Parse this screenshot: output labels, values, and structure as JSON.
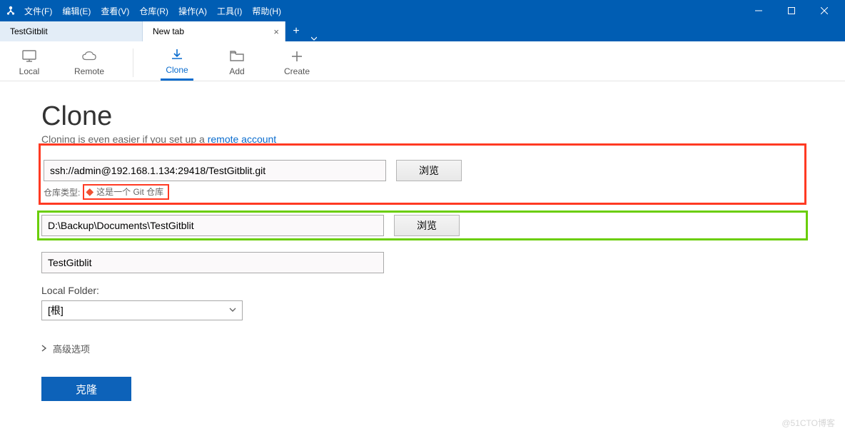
{
  "menu": {
    "file": "文件(F)",
    "edit": "编辑(E)",
    "view": "查看(V)",
    "repo": "仓库(R)",
    "action": "操作(A)",
    "tools": "工具(I)",
    "help": "帮助(H)"
  },
  "tabs": {
    "t1": "TestGitblit",
    "t2": "New tab"
  },
  "toolbar": {
    "local": "Local",
    "remote": "Remote",
    "clone": "Clone",
    "add": "Add",
    "create": "Create"
  },
  "page": {
    "heading": "Clone",
    "subtitle_pre": "Cloning is even easier if you set up a ",
    "subtitle_link": "remote account"
  },
  "form": {
    "url": "ssh://admin@192.168.1.134:29418/TestGitblit.git",
    "browse": "浏览",
    "repo_type_label": "仓库类型:",
    "repo_type_value": "这是一个 Git 仓库",
    "path": "D:\\Backup\\Documents\\TestGitblit",
    "name": "TestGitblit",
    "local_folder_label": "Local Folder:",
    "local_folder_value": "[根]",
    "advanced": "高级选项",
    "clone_btn": "克隆"
  },
  "watermark": "@51CTO博客"
}
